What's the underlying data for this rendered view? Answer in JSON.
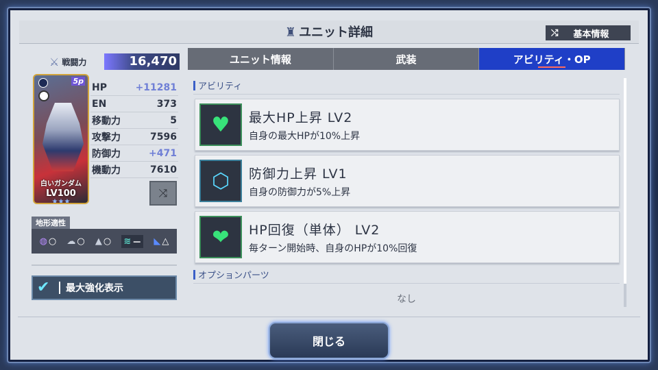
{
  "window": {
    "title": "ユニット詳細",
    "basic_info_label": "基本情報"
  },
  "left": {
    "combat_power_label": "戦闘力",
    "combat_power_value": "16,470",
    "unit_name": "白いガンダム",
    "level": "LV100",
    "stars": "★★★",
    "card_badge": "5p",
    "stats": [
      {
        "label": "HP",
        "value": "+11281",
        "boosted": true
      },
      {
        "label": "EN",
        "value": "373",
        "boosted": false
      },
      {
        "label": "移動力",
        "value": "5",
        "boosted": false
      },
      {
        "label": "攻撃力",
        "value": "7596",
        "boosted": false
      },
      {
        "label": "防御力",
        "value": "+471",
        "boosted": true
      },
      {
        "label": "機動力",
        "value": "7610",
        "boosted": false
      }
    ],
    "terrain_label": "地形適性",
    "terrain": [
      {
        "icon": "space-icon",
        "rating": "○"
      },
      {
        "icon": "air-icon",
        "rating": "○"
      },
      {
        "icon": "ground-icon",
        "rating": "○"
      },
      {
        "icon": "water-icon",
        "rating": "－"
      },
      {
        "icon": "underground-icon",
        "rating": "△"
      }
    ],
    "max_enhance_label": "最大強化表示"
  },
  "tabs": [
    {
      "label": "ユニット情報",
      "active": false
    },
    {
      "label": "武装",
      "active": false
    },
    {
      "label": "アビリティ・OP",
      "active": true
    }
  ],
  "abilities_section": "アビリティ",
  "abilities": [
    {
      "name": "最大HP上昇 LV2",
      "desc": "自身の最大HPが10%上昇",
      "icon": "heart-icon",
      "color": "#38e37a"
    },
    {
      "name": "防御力上昇 LV1",
      "desc": "自身の防御力が5%上昇",
      "icon": "shield-icon",
      "color": "#5ad8ff"
    },
    {
      "name": "HP回復（単体） LV2",
      "desc": "毎ターン開始時、自身のHPが10%回復",
      "icon": "heart-sparkle-icon",
      "color": "#38e37a"
    }
  ],
  "options_section": "オプションパーツ",
  "options_empty": "なし",
  "close_label": "閉じる"
}
